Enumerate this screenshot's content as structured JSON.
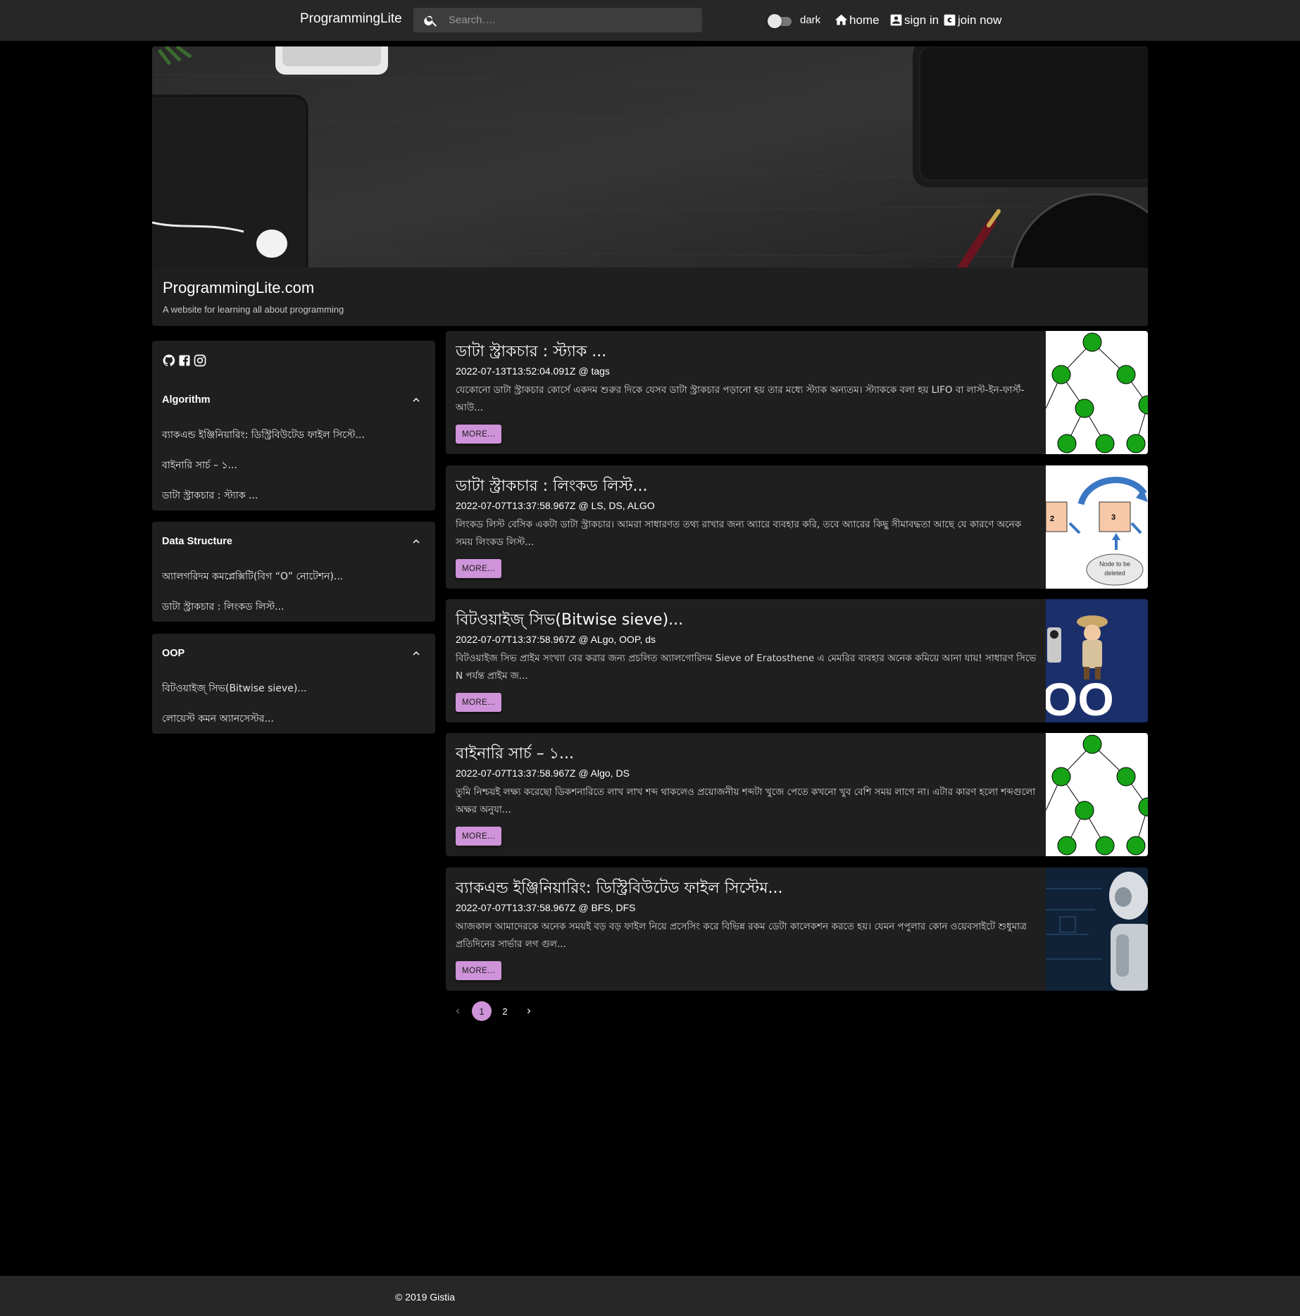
{
  "nav": {
    "brand": "ProgrammingLite",
    "search_placeholder": "Search….",
    "dark_label": "dark",
    "home_label": "home",
    "signin_label": "sign in",
    "join_label": "join now"
  },
  "banner": {
    "title": "ProgrammingLite.com",
    "subtitle": "A website for learning all about programming"
  },
  "sidebar": {
    "sections": [
      {
        "title": "Algorithm",
        "items": [
          "ব্যাকএন্ড ইঞ্জিনিয়ারিং: ডিস্ট্রিবিউটেড ফাইল সিস্টে...",
          "বাইনারি সার্চ – ১...",
          "ডাটা স্ট্রাকচার : স্ট্যাক ..."
        ]
      },
      {
        "title": "Data Structure",
        "items": [
          "অ্যালগরিদম কমপ্লেক্সিটি(বিগ “O” নোটেশন)...",
          "ডাটা স্ট্রাকচার : লিংকড লিস্ট..."
        ]
      },
      {
        "title": "OOP",
        "items": [
          "বিটওয়াইজ্ সিভ(Bitwise sieve)...",
          "লোয়েস্ট কমন অ্যানসেস্টর..."
        ]
      }
    ]
  },
  "posts": [
    {
      "title": "ডাটা স্ট্রাকচার : স্ট্যাক ...",
      "meta": "2022-07-13T13:52:04.091Z @ tags",
      "excerpt": "যেকোনো ডাটা স্ট্রাকচার কোর্সে একদম শুরুর দিকে যেসব ডাটা স্ট্রাকচার পড়ানো হয় তার মধ্যে স্ট্যাক অন্যতম। স্ট্যাককে বলা হয় LIFO বা লাস্ট-ইন-ফার্স্ট-আউ...",
      "more": "MORE..."
    },
    {
      "title": "ডাটা স্ট্রাকচার : লিংকড লিস্ট...",
      "meta": "2022-07-07T13:37:58.967Z @ LS, DS, ALGO",
      "excerpt": "লিংকড লিস্ট বেসিক একটা ডাটা স্ট্রাকচার। আমরা সাধারণত তথ্য রাখার জন্য অ্যারে ব্যবহার করি, তবে অ্যারের কিছু সীমাবদ্ধতা আছে যে কারণে অনেক সময় লিংকড লিস্ট...",
      "more": "MORE...",
      "thumb_labels": [
        "2",
        "3",
        "Node to be",
        "deleted"
      ]
    },
    {
      "title": "বিটওয়াইজ্ সিভ(Bitwise sieve)...",
      "meta": "2022-07-07T13:37:58.967Z @ ALgo, OOP, ds",
      "excerpt": "বিটওয়াইজ সিভ প্রাইম সংখ্যা বের করার জন্য প্রচলিত অ্যালগোরিদম Sieve of Eratosthene এ মেমরির ব্যবহার অনেক কমিয়ে আনা যায়! সাধারণ সিভে N পর্যন্ত প্রাইম জ...",
      "more": "MORE...",
      "thumb_labels": [
        "OO"
      ]
    },
    {
      "title": "বাইনারি সার্চ – ১...",
      "meta": "2022-07-07T13:37:58.967Z @ Algo, DS",
      "excerpt": "তুমি নিশ্চয়ই লক্ষ্য করেছো ডিকশনারিতে লাখ লাখ শব্দ থাকলেও প্রয়োজনীয় শব্দটা খুজে পেতে কখনো খুব বেশি সময় লাগে না। এটার কারণ হলো শব্দগুলো অক্ষর অনুযা...",
      "more": "MORE..."
    },
    {
      "title": "ব্যাকএন্ড ইঞ্জিনিয়ারিং: ডিস্ট্রিবিউটেড ফাইল সিস্টেম...",
      "meta": "2022-07-07T13:37:58.967Z @ BFS, DFS",
      "excerpt": "আজকাল আমাদেরকে অনেক সময়ই বড় বড় ফাইল নিয়ে প্রসেসিং করে বিভিন্ন রকম ডেটা কালেকশন করতে হয়। যেমন পপুলার কোন ওয়েবসাইটে শুধুমাত্র প্রতিদিনের সার্ভার লগ গুল...",
      "more": "MORE..."
    }
  ],
  "pagination": {
    "pages": [
      "1",
      "2"
    ],
    "current": "1"
  },
  "footer": {
    "text": "© 2019 Gistia"
  },
  "colors": {
    "accent": "#ce93d8",
    "topbar": "#272727",
    "card": "#1f1f1f",
    "background": "#000000"
  }
}
